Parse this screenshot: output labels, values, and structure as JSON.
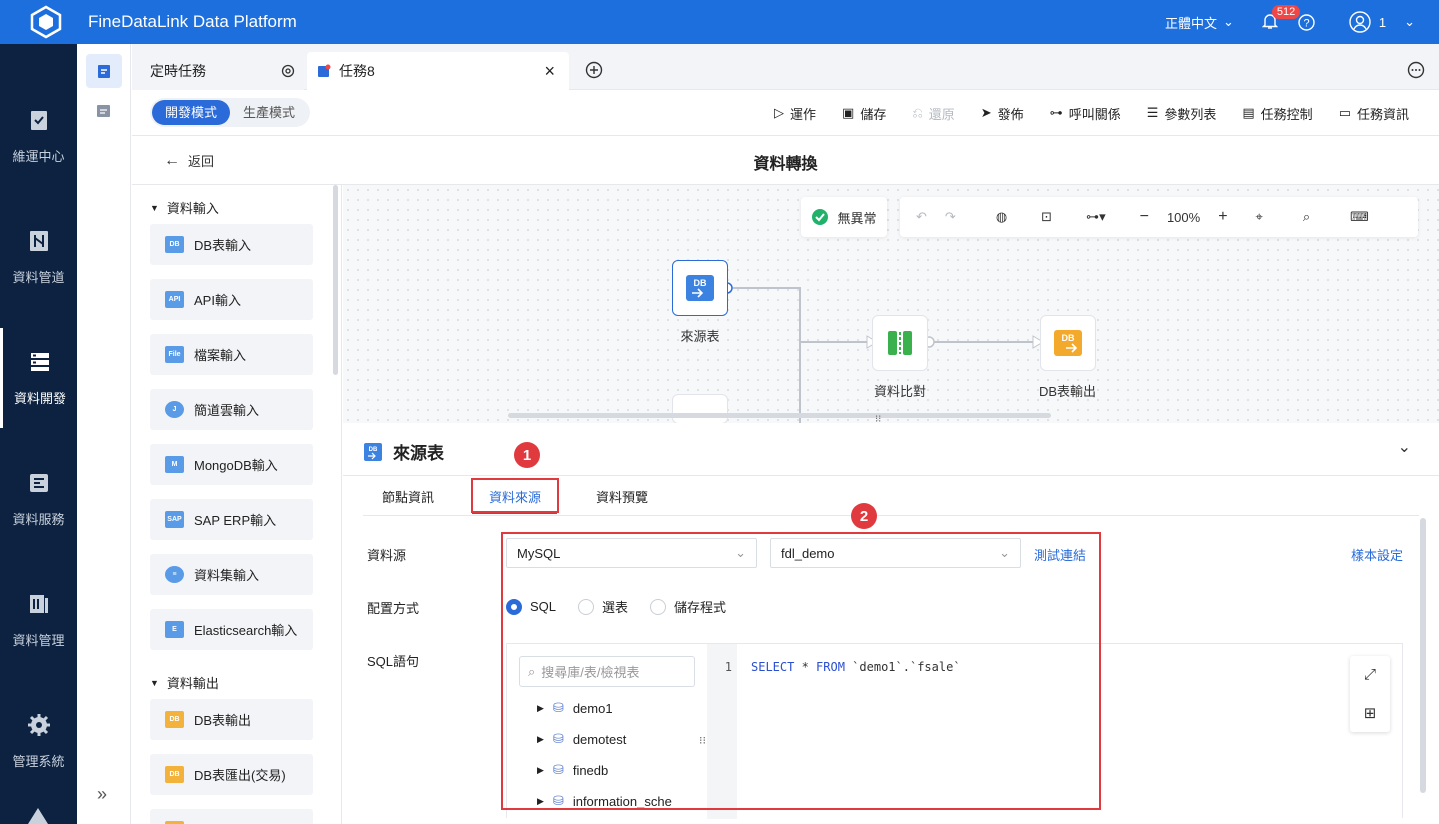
{
  "app": {
    "title": "FineDataLink Data Platform",
    "language": "正體中文",
    "notification_count": "512",
    "user": "1"
  },
  "leftnav": [
    {
      "label": "維運中心",
      "icon": "clipboard-check-icon"
    },
    {
      "label": "資料管道",
      "icon": "pipeline-icon"
    },
    {
      "label": "資料開發",
      "icon": "dev-icon",
      "active": true
    },
    {
      "label": "資料服務",
      "icon": "service-icon"
    },
    {
      "label": "資料管理",
      "icon": "manage-icon"
    },
    {
      "label": "管理系統",
      "icon": "gear-icon"
    }
  ],
  "tabs": [
    {
      "label": "定時任務"
    },
    {
      "label": "任務8"
    }
  ],
  "mode": {
    "dev": "開發模式",
    "prod": "生產模式"
  },
  "toolbar": {
    "run": "運作",
    "save": "儲存",
    "restore": "還原",
    "publish": "發佈",
    "call": "呼叫關係",
    "params": "參數列表",
    "control": "任務控制",
    "info": "任務資訊"
  },
  "header": {
    "back": "返回",
    "title": "資料轉換"
  },
  "palette": {
    "group_input": "資料輸入",
    "inputs": [
      "DB表輸入",
      "API輸入",
      "檔案輸入",
      "簡道雲輸入",
      "MongoDB輸入",
      "SAP ERP輸入",
      "資料集輸入",
      "Elasticsearch輸入"
    ],
    "group_output": "資料輸出",
    "outputs": [
      "DB表輸出",
      "DB表匯出(交易)"
    ]
  },
  "canvas": {
    "status": "無異常",
    "zoom": "100%",
    "nodes": {
      "source": "來源表",
      "compare": "資料比對",
      "output": "DB表輸出"
    }
  },
  "panel": {
    "title": "來源表",
    "tabs": {
      "node_info": "節點資訊",
      "data_source": "資料來源",
      "preview": "資料預覽"
    },
    "labels": {
      "source": "資料源",
      "config": "配置方式",
      "sql": "SQL語句"
    },
    "datasource": "MySQL",
    "database": "fdl_demo",
    "test_link": "測試連結",
    "sample_link": "樣本設定",
    "config_options": [
      "SQL",
      "選表",
      "儲存程式"
    ],
    "search_placeholder": "搜尋庫/表/檢視表",
    "tree": [
      "demo1",
      "demotest",
      "finedb",
      "information_sche"
    ],
    "line_no": "1",
    "sql_kw1": "SELECT",
    "sql_mid": " * ",
    "sql_kw2": "FROM",
    "sql_rest": " `demo1`.`fsale`"
  },
  "markers": [
    "1",
    "2"
  ],
  "colors": {
    "primary": "#1c6fdc",
    "nav": "#0c2240",
    "annotation": "#e0393e"
  }
}
